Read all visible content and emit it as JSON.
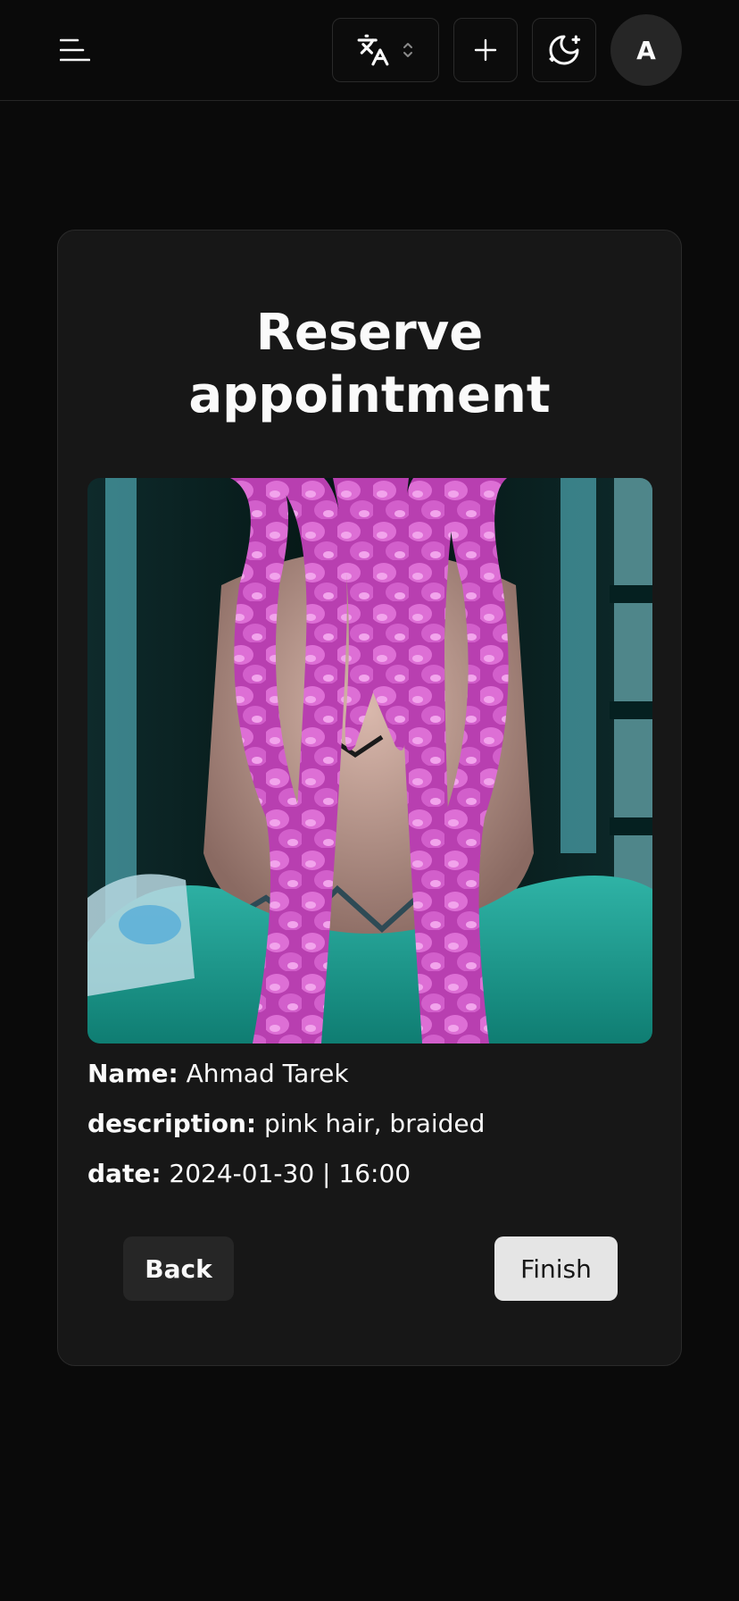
{
  "header": {
    "menu_icon": "hamburger-menu-icon",
    "language_icon": "translate-icon",
    "language_chevron_icon": "chevrons-up-down-icon",
    "add_icon": "plus-icon",
    "theme_icon": "moon-stars-icon",
    "avatar_initial": "A"
  },
  "card": {
    "title": "Reserve appointment",
    "photo_description": "Back of a person's head with pink braided hair and a teal top",
    "name_label": "Name:",
    "name_value": "Ahmad Tarek",
    "description_label": "description:",
    "description_value": "pink hair, braided",
    "date_label": "date:",
    "date_value": "2024-01-30 | 16:00",
    "back_label": "Back",
    "finish_label": "Finish"
  },
  "colors": {
    "background": "#0a0a0a",
    "card": "#171717",
    "border": "#2a2a2a",
    "secondary_button": "#262626",
    "primary_button": "#e5e5e5"
  }
}
